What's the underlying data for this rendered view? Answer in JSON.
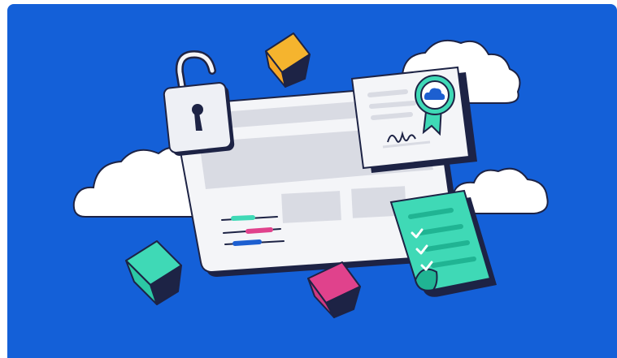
{
  "illustration": {
    "theme": "cloud-security-compliance",
    "colors": {
      "background": "#1460d8",
      "outline": "#1d2345",
      "cloud": "#ffffff",
      "panel": "#f4f5f8",
      "panel_block": "#d9dbe3",
      "teal": "#3fd9b6",
      "teal_dark": "#20b493",
      "pink": "#e0428c",
      "yellow": "#f5b42e",
      "cube_shadow": "#1d2345"
    },
    "icons": [
      "cloud-icon",
      "browser-window-icon",
      "padlock-icon",
      "certificate-icon",
      "award-ribbon-icon",
      "checklist-icon",
      "cube-icon"
    ]
  }
}
